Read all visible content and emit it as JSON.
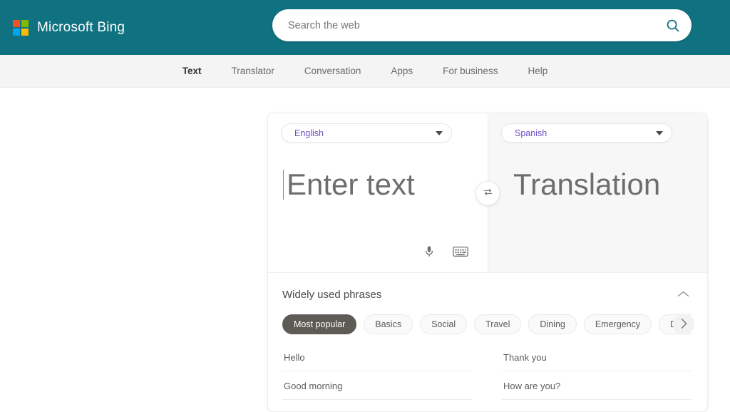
{
  "header": {
    "brand": "Microsoft Bing",
    "logo_icon": "microsoft-logo-icon",
    "search": {
      "placeholder": "Search the web",
      "value": "",
      "icon": "search-icon"
    },
    "colors": {
      "background": "#107180",
      "accent": "#6B4FC0"
    }
  },
  "subnav": {
    "items": [
      {
        "label": "Text",
        "active": true
      },
      {
        "label": "Translator",
        "active": false
      },
      {
        "label": "Conversation",
        "active": false
      },
      {
        "label": "Apps",
        "active": false
      },
      {
        "label": "For business",
        "active": false
      },
      {
        "label": "Help",
        "active": false
      }
    ]
  },
  "translator": {
    "source": {
      "language": "English",
      "placeholder": "Enter text",
      "caret_visible": true,
      "tools": [
        {
          "name": "microphone-icon",
          "label": "Speak"
        },
        {
          "name": "keyboard-icon",
          "label": "Keyboard"
        }
      ]
    },
    "target": {
      "language": "Spanish",
      "placeholder": "Translation"
    },
    "swap_icon": "swap-languages-icon",
    "dropdown_icon": "chevron-down-icon"
  },
  "phrases": {
    "title": "Widely used phrases",
    "collapse_icon": "chevron-up-icon",
    "next_icon": "chevron-right-icon",
    "categories": [
      {
        "label": "Most popular",
        "selected": true
      },
      {
        "label": "Basics",
        "selected": false
      },
      {
        "label": "Social",
        "selected": false
      },
      {
        "label": "Travel",
        "selected": false
      },
      {
        "label": "Dining",
        "selected": false
      },
      {
        "label": "Emergency",
        "selected": false
      },
      {
        "label": "Dates & numbers",
        "selected": false
      }
    ],
    "items": [
      "Hello",
      "Thank you",
      "Good morning",
      "How are you?"
    ]
  }
}
